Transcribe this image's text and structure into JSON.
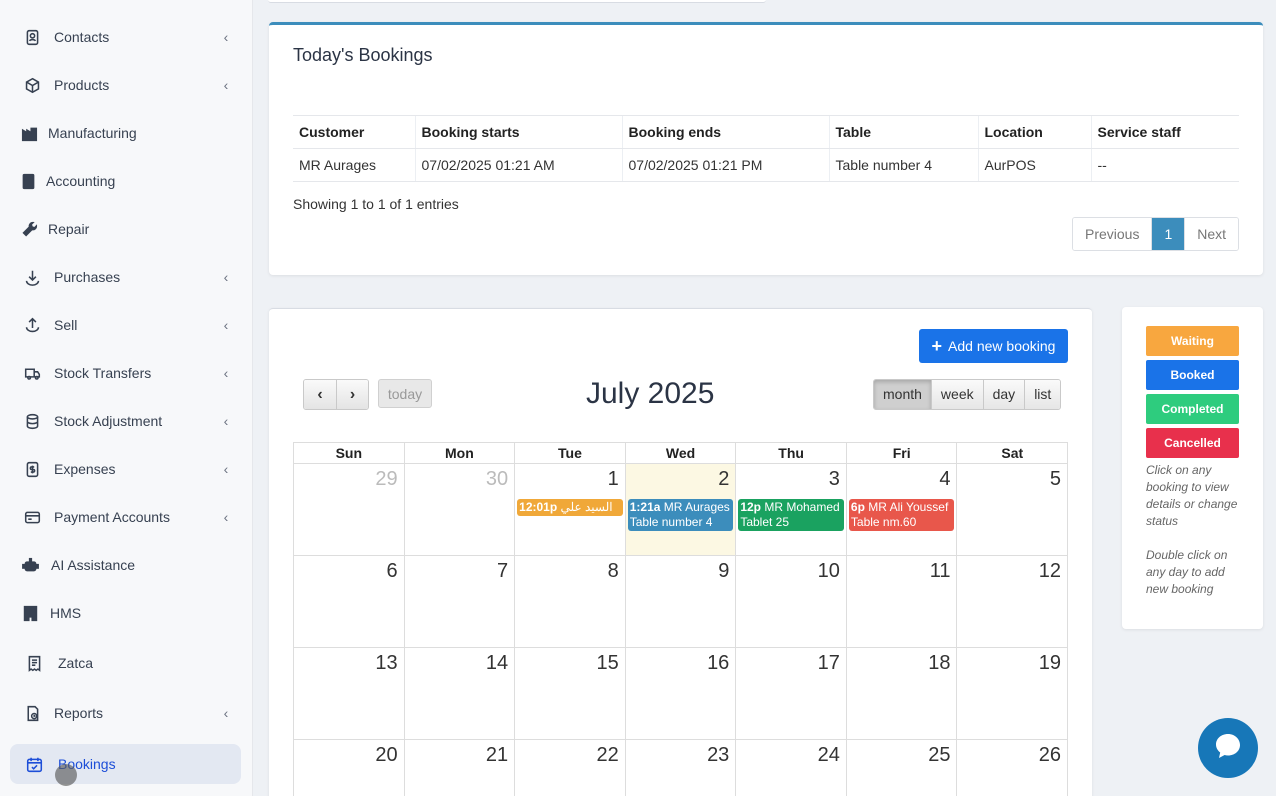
{
  "sidebar": {
    "items": [
      {
        "label": "Contacts",
        "icon": "contacts-icon",
        "chevron": "‹"
      },
      {
        "label": "Products",
        "icon": "cube-icon",
        "chevron": "‹"
      },
      {
        "label": "Manufacturing",
        "icon": "factory-icon",
        "chevron": ""
      },
      {
        "label": "Accounting",
        "icon": "book-icon",
        "chevron": ""
      },
      {
        "label": "Repair",
        "icon": "wrench-icon",
        "chevron": ""
      },
      {
        "label": "Purchases",
        "icon": "download-icon",
        "chevron": "‹"
      },
      {
        "label": "Sell",
        "icon": "upload-icon",
        "chevron": "‹"
      },
      {
        "label": "Stock Transfers",
        "icon": "truck-icon",
        "chevron": "‹"
      },
      {
        "label": "Stock Adjustment",
        "icon": "database-icon",
        "chevron": "‹"
      },
      {
        "label": "Expenses",
        "icon": "dollar-icon",
        "chevron": "‹"
      },
      {
        "label": "Payment Accounts",
        "icon": "credit-card-icon",
        "chevron": "‹"
      },
      {
        "label": "AI Assistance",
        "icon": "robot-icon",
        "chevron": ""
      },
      {
        "label": "HMS",
        "icon": "building-icon",
        "chevron": ""
      },
      {
        "label": "Zatca",
        "icon": "receipt-icon",
        "chevron": ""
      },
      {
        "label": "Reports",
        "icon": "report-icon",
        "chevron": "‹"
      },
      {
        "label": "Bookings",
        "icon": "calendar-check-icon",
        "chevron": ""
      }
    ]
  },
  "bookings": {
    "title": "Today's Bookings",
    "columns": [
      "Customer",
      "Booking starts",
      "Booking ends",
      "Table",
      "Location",
      "Service staff"
    ],
    "rows": [
      [
        "MR Aurages",
        "07/02/2025 01:21 AM",
        "07/02/2025 01:21 PM",
        "Table number 4",
        "AurPOS",
        "--"
      ]
    ],
    "showing": "Showing 1 to 1 of 1 entries",
    "pager": {
      "previous": "Previous",
      "page": "1",
      "next": "Next"
    }
  },
  "calendar": {
    "add_button": "Add new booking",
    "prev": "‹",
    "next": "›",
    "today": "today",
    "title": "July 2025",
    "views": [
      "month",
      "week",
      "day",
      "list"
    ],
    "active_view": "month",
    "weekdays": [
      "Sun",
      "Mon",
      "Tue",
      "Wed",
      "Thu",
      "Fri",
      "Sat"
    ],
    "weeks": [
      [
        "29",
        "30",
        "1",
        "2",
        "3",
        "4",
        "5"
      ],
      [
        "6",
        "7",
        "8",
        "9",
        "10",
        "11",
        "12"
      ],
      [
        "13",
        "14",
        "15",
        "16",
        "17",
        "18",
        "19"
      ],
      [
        "20",
        "21",
        "22",
        "23",
        "24",
        "25",
        "26"
      ]
    ],
    "events": [
      {
        "day": "1",
        "time": "12:01p",
        "text": "السيد علي",
        "line2": "",
        "color": "#f0a839"
      },
      {
        "day": "2",
        "time": "1:21a",
        "text": "MR Aurages",
        "line2": "Table number 4",
        "color": "#3c8dbc"
      },
      {
        "day": "3",
        "time": "12p",
        "text": "MR Mohamed",
        "line2": "Tablet 25",
        "color": "#1aa260"
      },
      {
        "day": "4",
        "time": "6p",
        "text": "MR Ali Youssef",
        "line2": "Table nm.60",
        "color": "#e8574b"
      }
    ]
  },
  "legend": {
    "items": [
      {
        "label": "Waiting",
        "color": "#f8a73f"
      },
      {
        "label": "Booked",
        "color": "#1a73e8"
      },
      {
        "label": "Completed",
        "color": "#2ecc7e"
      },
      {
        "label": "Cancelled",
        "color": "#e8304c"
      }
    ],
    "note1": "Click on any booking to view details or change status",
    "note2": "Double click on any day to add new booking"
  }
}
